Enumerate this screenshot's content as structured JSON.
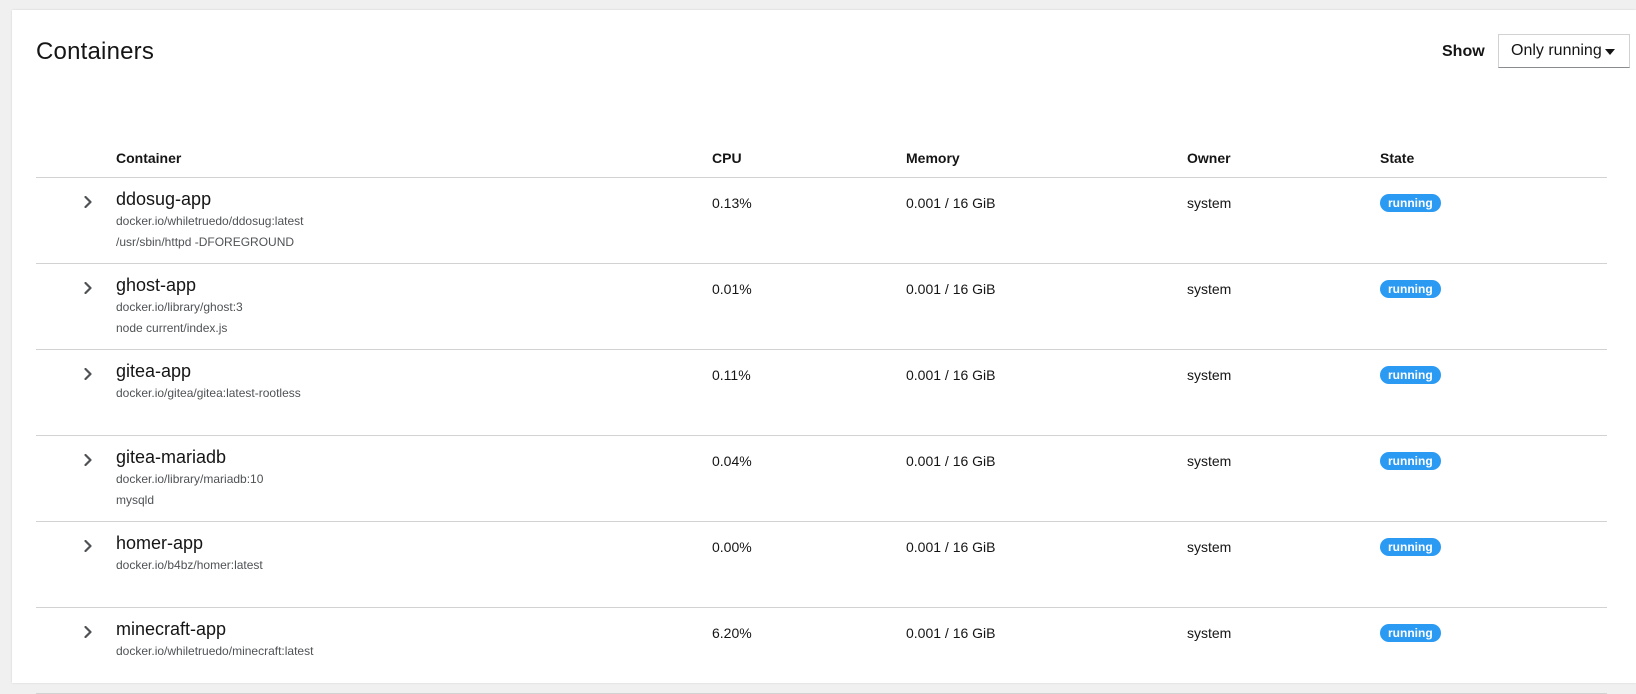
{
  "header": {
    "title": "Containers",
    "show_label": "Show",
    "filter_value": "Only running"
  },
  "table": {
    "columns": [
      "Container",
      "CPU",
      "Memory",
      "Owner",
      "State"
    ],
    "rows": [
      {
        "name": "ddosug-app",
        "image": "docker.io/whiletruedo/ddosug:latest",
        "command": "/usr/sbin/httpd -DFOREGROUND",
        "cpu": "0.13%",
        "memory": "0.001 / 16 GiB",
        "owner": "system",
        "state": "running"
      },
      {
        "name": "ghost-app",
        "image": "docker.io/library/ghost:3",
        "command": "node current/index.js",
        "cpu": "0.01%",
        "memory": "0.001 / 16 GiB",
        "owner": "system",
        "state": "running"
      },
      {
        "name": "gitea-app",
        "image": "docker.io/gitea/gitea:latest-rootless",
        "command": "",
        "cpu": "0.11%",
        "memory": "0.001 / 16 GiB",
        "owner": "system",
        "state": "running"
      },
      {
        "name": "gitea-mariadb",
        "image": "docker.io/library/mariadb:10",
        "command": "mysqld",
        "cpu": "0.04%",
        "memory": "0.001 / 16 GiB",
        "owner": "system",
        "state": "running"
      },
      {
        "name": "homer-app",
        "image": "docker.io/b4bz/homer:latest",
        "command": "",
        "cpu": "0.00%",
        "memory": "0.001 / 16 GiB",
        "owner": "system",
        "state": "running"
      },
      {
        "name": "minecraft-app",
        "image": "docker.io/whiletruedo/minecraft:latest",
        "command": "",
        "cpu": "6.20%",
        "memory": "0.001 / 16 GiB",
        "owner": "system",
        "state": "running"
      }
    ]
  },
  "colors": {
    "badge_running": "#2b9af3",
    "divider": "#d2d2d2",
    "secondary_text": "#4f5255"
  },
  "icons": {
    "expand": "chevron-right-icon",
    "dropdown": "caret-down-icon"
  }
}
